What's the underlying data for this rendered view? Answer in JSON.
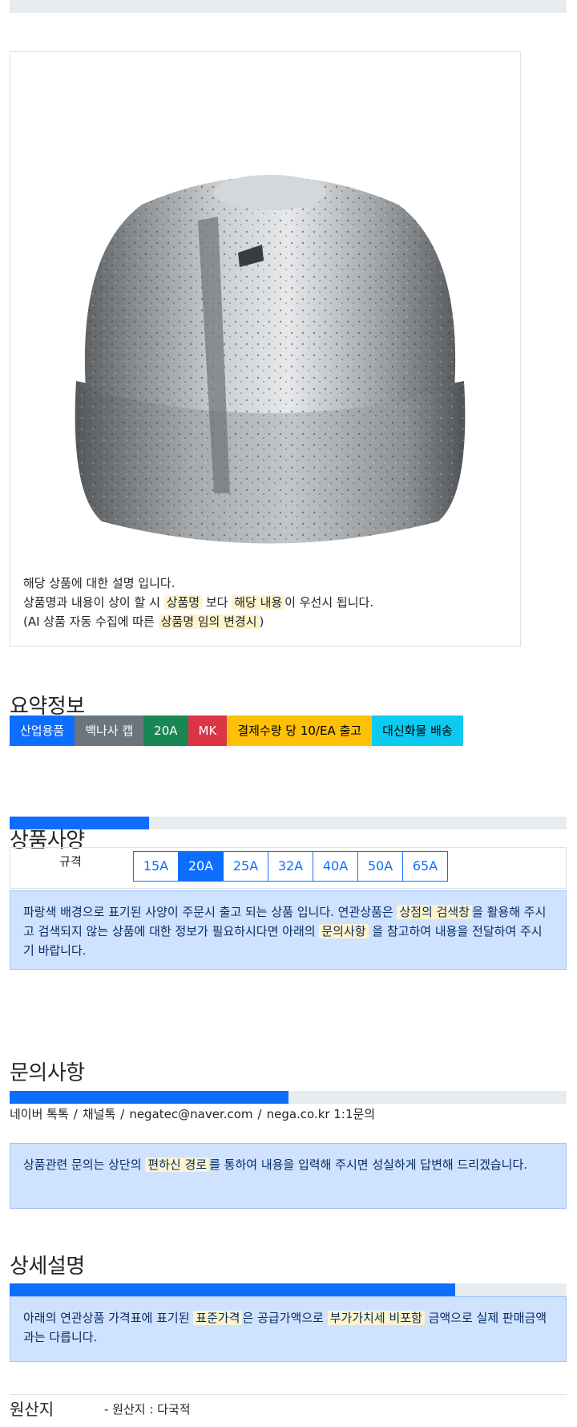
{
  "colors": {
    "primary": "#0d6efd",
    "secondary": "#6c757d",
    "success": "#198754",
    "danger": "#dc3545",
    "warning": "#ffc107",
    "info": "#0dcaf0",
    "highlight": "#fff3cd",
    "alert_bg": "#cfe2ff"
  },
  "product": {
    "image_icon": "pipe-cap-photo",
    "desc_line1": "해당 상품에 대한 설명 입니다.",
    "desc_line2": {
      "pre": "상품명과 내용이 상이 할 시 ",
      "hl1": "상품명",
      "mid": " 보다 ",
      "hl2": "해당 내용",
      "post": "이 우선시 됩니다."
    },
    "desc_line3": {
      "pre": "(AI 상품 자동 수집에 따른 ",
      "hl": "상품명 임의 변경시",
      "post": ")"
    }
  },
  "summary": {
    "title": "요약정보",
    "badges": [
      "산업용품",
      "백나사 캡",
      "20A",
      "MK",
      "결제수량 당 10/EA 출고",
      "대신화물 배송"
    ]
  },
  "spec": {
    "progress": 0.25,
    "title": "상품사양",
    "label": "규격",
    "options": [
      "15A",
      "20A",
      "25A",
      "32A",
      "40A",
      "50A",
      "65A"
    ],
    "selected": "20A",
    "notice": {
      "pre": "파랑색 배경으로 표기된 사양이 주문시 출고 되는 상품 입니다. 연관상품은 ",
      "hl1": "상점의 검색창",
      "mid": "을 활용해 주시고 검색되지 않는 상품에 대한 정보가 필요하시다면 아래의 ",
      "hl2": "문의사항",
      "post": " 을 참고하여 내용을 전달하여 주시기 바랍니다."
    }
  },
  "inquiry": {
    "progress": 0.5,
    "title": "문의사항",
    "links": [
      "네이버 톡톡",
      "채널톡",
      "negatec@naver.com",
      "nega.co.kr 1:1문의"
    ],
    "separator": "/",
    "notice": {
      "pre": "상품관련 문의는 상단의 ",
      "hl": "편하신 경로",
      "post": "를 통하여 내용을 입력해 주시면 성실하게 답변해 드리겠습니다."
    }
  },
  "detail": {
    "progress": 0.8,
    "title": "상세설명",
    "notice": {
      "pre": "아래의 연관상품 가격표에 표기된 ",
      "hl1": "표준가격",
      "mid": "은 공급가액으로 ",
      "hl2": "부가가치세 비포함",
      "post": " 금액으로 실제 판매금액과는 다릅니다."
    }
  },
  "origin": {
    "title": "원산지",
    "value": "- 원산지 : 다국적"
  }
}
